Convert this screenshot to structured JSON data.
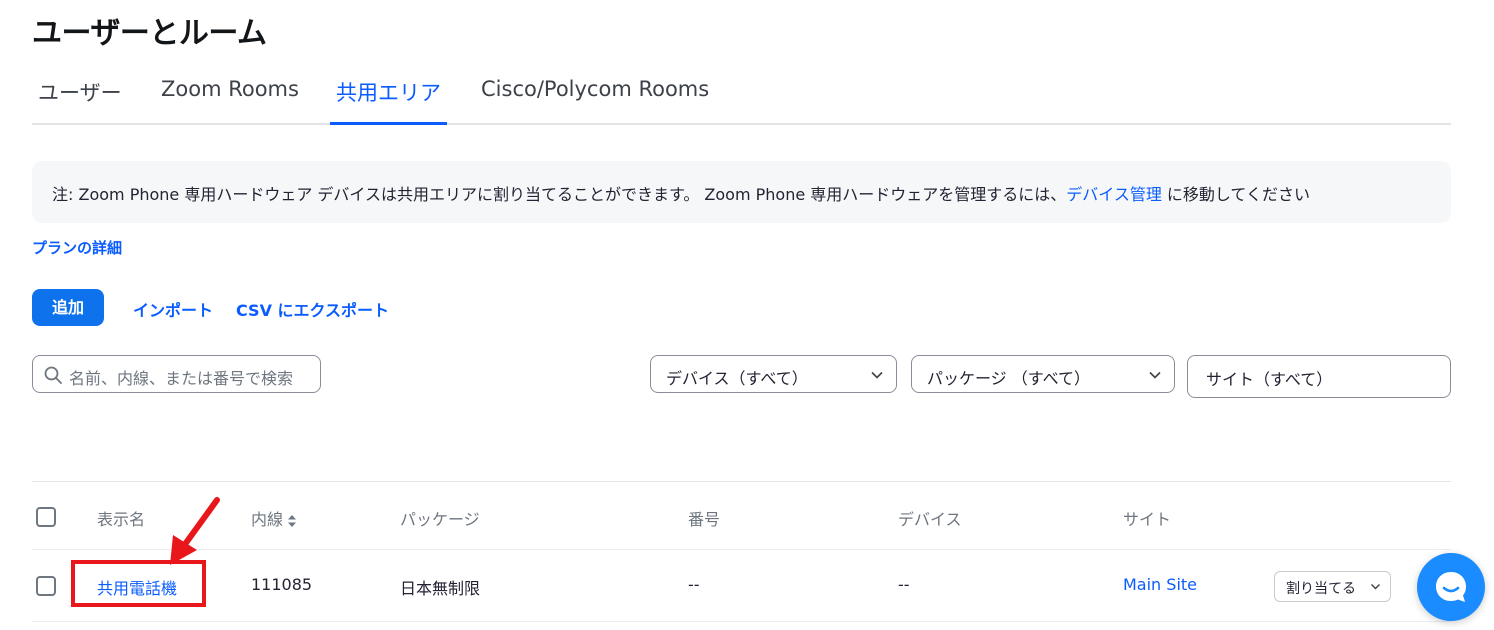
{
  "page": {
    "title": "ユーザーとルーム"
  },
  "tabs": [
    {
      "label": "ユーザー",
      "active": false
    },
    {
      "label": "Zoom Rooms",
      "active": false
    },
    {
      "label": "共用エリア",
      "active": true
    },
    {
      "label": "Cisco/Polycom Rooms",
      "active": false
    }
  ],
  "notice": {
    "text_before": "注: Zoom Phone 専用ハードウェア デバイスは共用エリアに割り当てることができます。 Zoom Phone 専用ハードウェアを管理するには、",
    "link_text": "デバイス管理",
    "text_after": " に移動してください"
  },
  "plan_link": "プランの詳細",
  "actions": {
    "add_label": "追加",
    "import_label": "インポート",
    "export_label": "CSV にエクスポート"
  },
  "search": {
    "placeholder": "名前、内線、または番号で検索",
    "icon": "search-icon"
  },
  "filters": [
    {
      "label": "デバイス（すべて）"
    },
    {
      "label": "パッケージ （すべて）"
    },
    {
      "label": "サイト（すべて）"
    }
  ],
  "table": {
    "columns": [
      "表示名",
      "内線",
      "パッケージ",
      "番号",
      "デバイス",
      "サイト"
    ],
    "sortable_column": "内線",
    "rows": [
      {
        "display_name": "共用電話機",
        "extension": "111085",
        "package": "日本無制限",
        "number": "--",
        "device": "--",
        "site": "Main Site",
        "action_label": "割り当てる"
      }
    ]
  },
  "annotation": {
    "highlight_color": "#e8171b"
  },
  "colors": {
    "accent": "#0b5cff",
    "button_primary": "#0e72ed",
    "chat": "#1a8cff"
  }
}
